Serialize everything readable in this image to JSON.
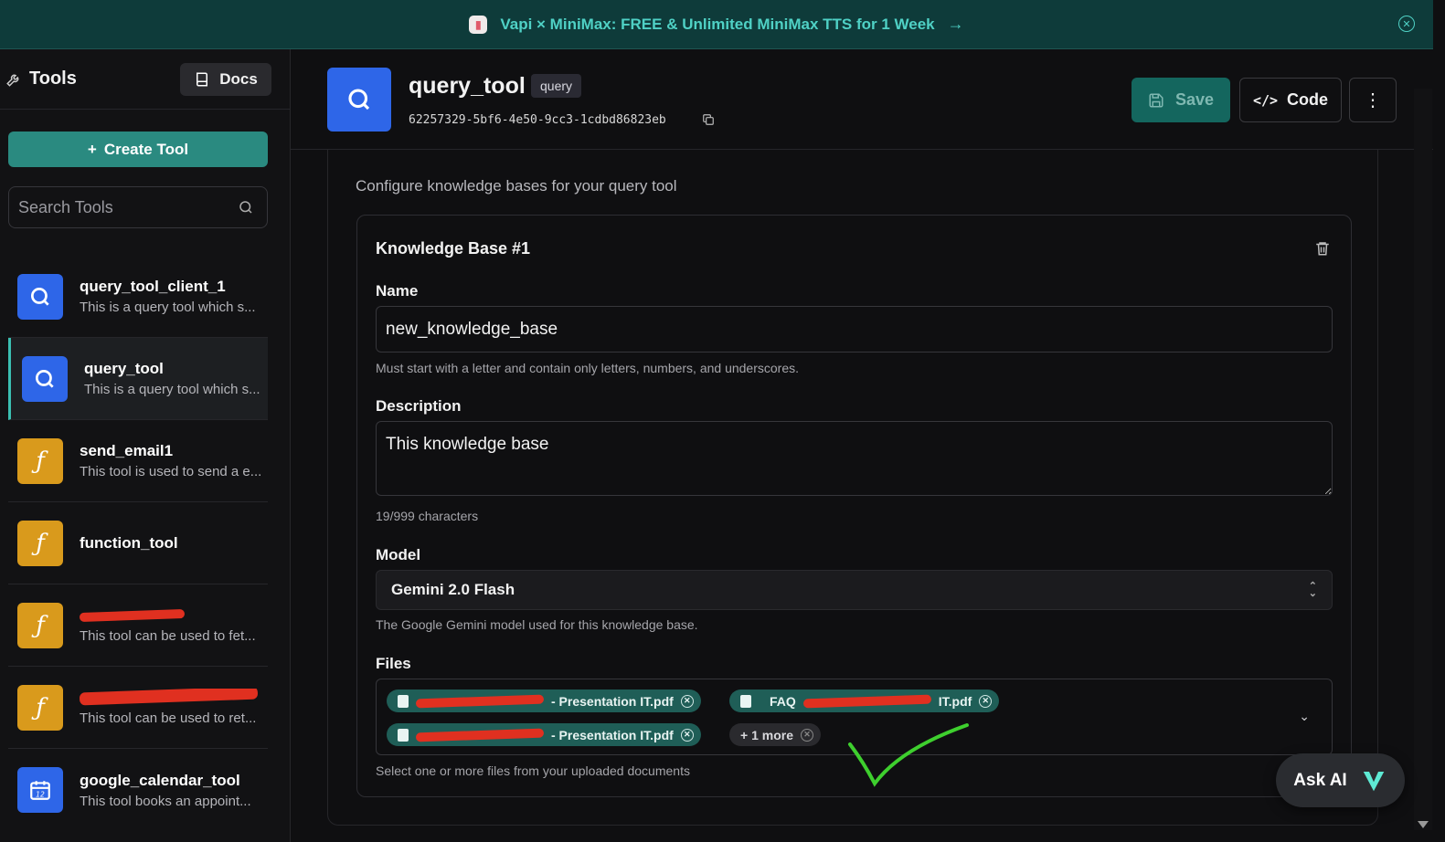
{
  "banner": {
    "text": "Vapi × MiniMax: FREE & Unlimited MiniMax TTS for 1 Week",
    "arrow": "→",
    "close_icon": "close-circle-icon"
  },
  "sidebar": {
    "title": "Tools",
    "docs_label": "Docs",
    "create_label": "Create Tool",
    "search_placeholder": "Search Tools",
    "tools": [
      {
        "name": "query_tool_client_1",
        "desc": "This is a query tool which s...",
        "icon": "search-icon",
        "color": "#2e66e8"
      },
      {
        "name": "query_tool",
        "desc": "This is a query tool which s...",
        "icon": "search-icon",
        "color": "#2e66e8",
        "active": true
      },
      {
        "name": "send_email1",
        "desc": "This tool is used to send a e...",
        "icon": "function-icon",
        "color": "#d99a1c"
      },
      {
        "name": "function_tool",
        "desc": "",
        "icon": "function-icon",
        "color": "#d99a1c"
      },
      {
        "name": "",
        "desc": "This tool can be used to fet...",
        "icon": "function-icon",
        "color": "#d99a1c",
        "redacted": true
      },
      {
        "name": "",
        "desc": "This tool can be used to ret...",
        "icon": "function-icon",
        "color": "#d99a1c",
        "redacted": true
      },
      {
        "name": "google_calendar_tool",
        "desc": "This tool books an appoint...",
        "icon": "calendar-icon",
        "color": "#2e66e8"
      }
    ]
  },
  "header": {
    "title": "query_tool",
    "badge": "query",
    "id": "62257329-5bf6-4e50-9cc3-1cdbd86823eb",
    "save_label": "Save",
    "code_label": "Code"
  },
  "panel": {
    "subtitle": "Configure knowledge bases for your query tool",
    "kb_title": "Knowledge Base #1",
    "name_label": "Name",
    "name_value": "new_knowledge_base",
    "name_hint": "Must start with a letter and contain only letters, numbers, and underscores.",
    "desc_label": "Description",
    "desc_value": "This knowledge base",
    "char_count": "19/999 characters",
    "model_label": "Model",
    "model_value": "Gemini 2.0 Flash",
    "model_hint": "The Google Gemini model used for this knowledge base.",
    "files_label": "Files",
    "files": [
      {
        "label": "- Presentation IT.pdf"
      },
      {
        "prefix": "FAQ",
        "label": "IT.pdf"
      },
      {
        "label": "- Presentation IT.pdf"
      }
    ],
    "more_label": "+ 1 more",
    "files_hint": "Select one or more files from your uploaded documents"
  },
  "askai": {
    "label": "Ask AI"
  },
  "colors": {
    "accent": "#2a8a80",
    "brand_blue": "#2e66e8",
    "function_orange": "#d99a1c"
  }
}
